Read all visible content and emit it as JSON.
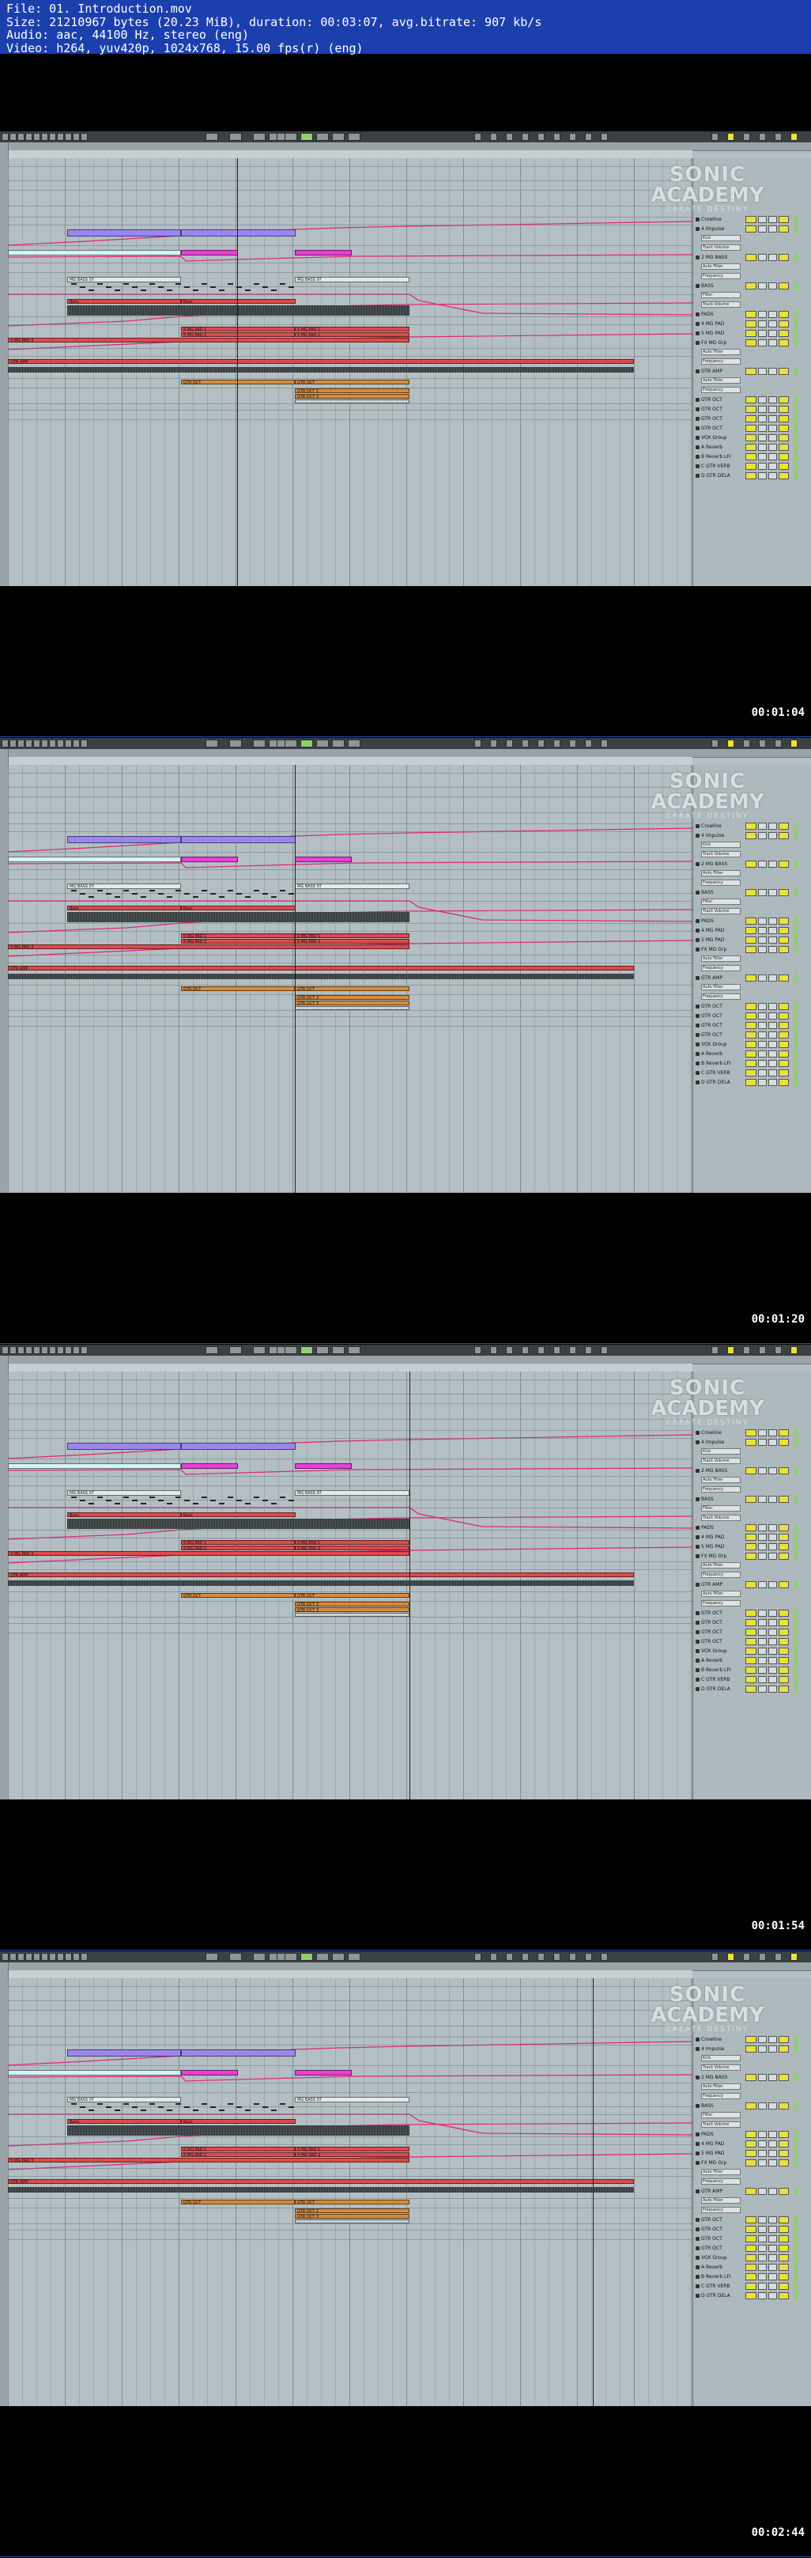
{
  "file_info": {
    "line1": "File: 01. Introduction.mov",
    "line2": "Size: 21210967 bytes (20.23 MiB), duration: 00:03:07, avg.bitrate: 907 kb/s",
    "line3": "Audio: aac, 44100 Hz, stereo (eng)",
    "line4": "Video: h264, yuv420p, 1024x768, 15.00 fps(r) (eng)"
  },
  "watermark": {
    "line1": "SONIC",
    "line2": "ACADEMY",
    "line3": "CREATE DESTINY"
  },
  "colors": {
    "info_bar": "#1c3fae",
    "clip_purple": "#9b86ef",
    "clip_magenta": "#e93fd7",
    "clip_red": "#dd4a4b",
    "clip_orange": "#d88a3a",
    "automation": "#e0237a"
  },
  "frames": [
    {
      "timestamp": "00:01:04"
    },
    {
      "timestamp": "00:01:20"
    },
    {
      "timestamp": "00:01:54"
    },
    {
      "timestamp": "00:02:44"
    }
  ],
  "clips": {
    "bass_a": "MG BASS 07",
    "bass_b": "MG BASS 07",
    "bass_label": "Bass",
    "pad1": "5 MG PAD 1",
    "pad2": "5 MG PAD 2",
    "pad3": "5 MG PAD 1",
    "pad4": "5 MG PAD 2",
    "pad_red_long": "5 MG PAD 3",
    "gtr_amp": "GTR AMP",
    "gtr_amp2": "GTR AMP",
    "gtr_amp3": "GTR AMP",
    "gtr_oct": "GTR OCT",
    "gtr_oct2": "GTR OCT",
    "gtr_oct3": "GTR OCT 2",
    "gtr_oct4": "GTR OCT 3"
  },
  "tracks": [
    {
      "name": "Crowline"
    },
    {
      "name": "4 Impulse"
    },
    {
      "name": "Kick",
      "sub": true
    },
    {
      "name": "Track Volume",
      "sub": true
    },
    {
      "name": "2 MG BASS"
    },
    {
      "name": "Auto Filter",
      "sub": true
    },
    {
      "name": "Frequency",
      "sub": true
    },
    {
      "name": "BASS"
    },
    {
      "name": "Filter",
      "sub": true
    },
    {
      "name": "Track Volume",
      "sub": true
    },
    {
      "name": "PADS"
    },
    {
      "name": "4 MG PAD"
    },
    {
      "name": "5 MG PAD"
    },
    {
      "name": "FX MG Grp"
    },
    {
      "name": "Auto Filter",
      "sub": true
    },
    {
      "name": "Frequency",
      "sub": true
    },
    {
      "name": "GTR AMP"
    },
    {
      "name": "Auto Filter",
      "sub": true
    },
    {
      "name": "Frequency",
      "sub": true
    },
    {
      "name": "GTR OCT"
    },
    {
      "name": "GTR OCT"
    },
    {
      "name": "GTR OCT"
    },
    {
      "name": "GTR OCT"
    },
    {
      "name": "VOX Group"
    },
    {
      "name": "A Reverb"
    },
    {
      "name": "B Reverb LFI"
    },
    {
      "name": "C GTR VERB"
    },
    {
      "name": "D GTR DELA"
    }
  ]
}
